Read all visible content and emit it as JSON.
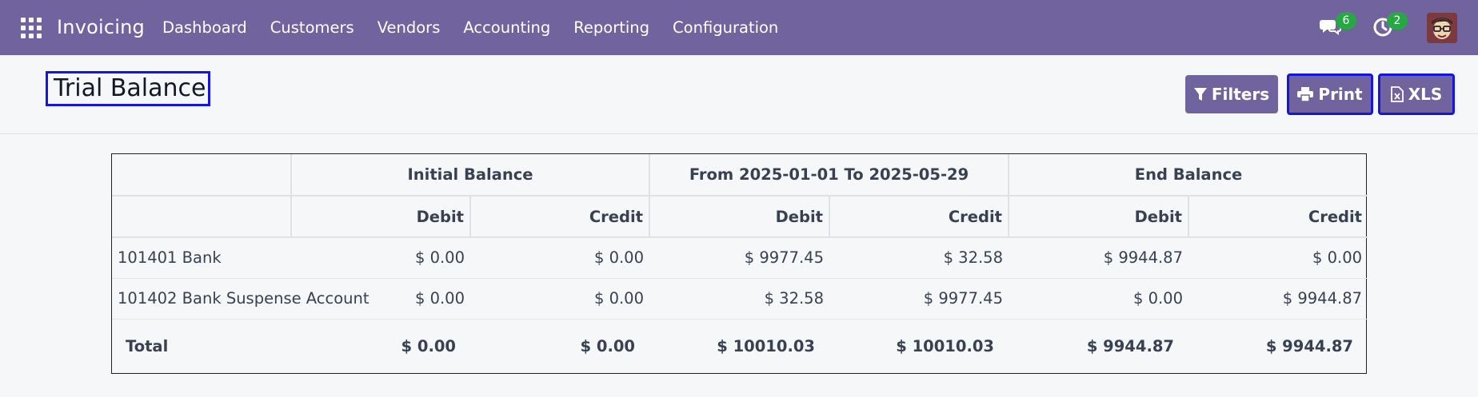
{
  "navbar": {
    "app_name": "Invoicing",
    "menu": [
      "Dashboard",
      "Customers",
      "Vendors",
      "Accounting",
      "Reporting",
      "Configuration"
    ],
    "messages_count": "6",
    "activities_count": "2",
    "icons": [
      "apps-grid-icon",
      "chat-icon",
      "activity-clock-icon",
      "user-avatar"
    ]
  },
  "page": {
    "title": "Trial Balance",
    "buttons": {
      "filters": "Filters",
      "print": "Print",
      "xls": "XLS"
    }
  },
  "report": {
    "group_headers": [
      "Initial Balance",
      "From 2025-01-01 To 2025-05-29",
      "End Balance"
    ],
    "col_headers": [
      "Debit",
      "Credit",
      "Debit",
      "Credit",
      "Debit",
      "Credit"
    ],
    "rows": [
      {
        "account": "101401 Bank",
        "values": [
          "$ 0.00",
          "$ 0.00",
          "$ 9977.45",
          "$ 32.58",
          "$ 9944.87",
          "$ 0.00"
        ]
      },
      {
        "account": "101402 Bank Suspense Account",
        "values": [
          "$ 0.00",
          "$ 0.00",
          "$ 32.58",
          "$ 9977.45",
          "$ 0.00",
          "$ 9944.87"
        ]
      }
    ],
    "total": {
      "label": "Total",
      "values": [
        "$ 0.00",
        "$ 0.00",
        "$ 10010.03",
        "$ 10010.03",
        "$ 9944.87",
        "$ 9944.87"
      ]
    }
  },
  "colors": {
    "brand": "#71639e",
    "badge": "#28a745",
    "highlight_border": "#1515e0"
  }
}
